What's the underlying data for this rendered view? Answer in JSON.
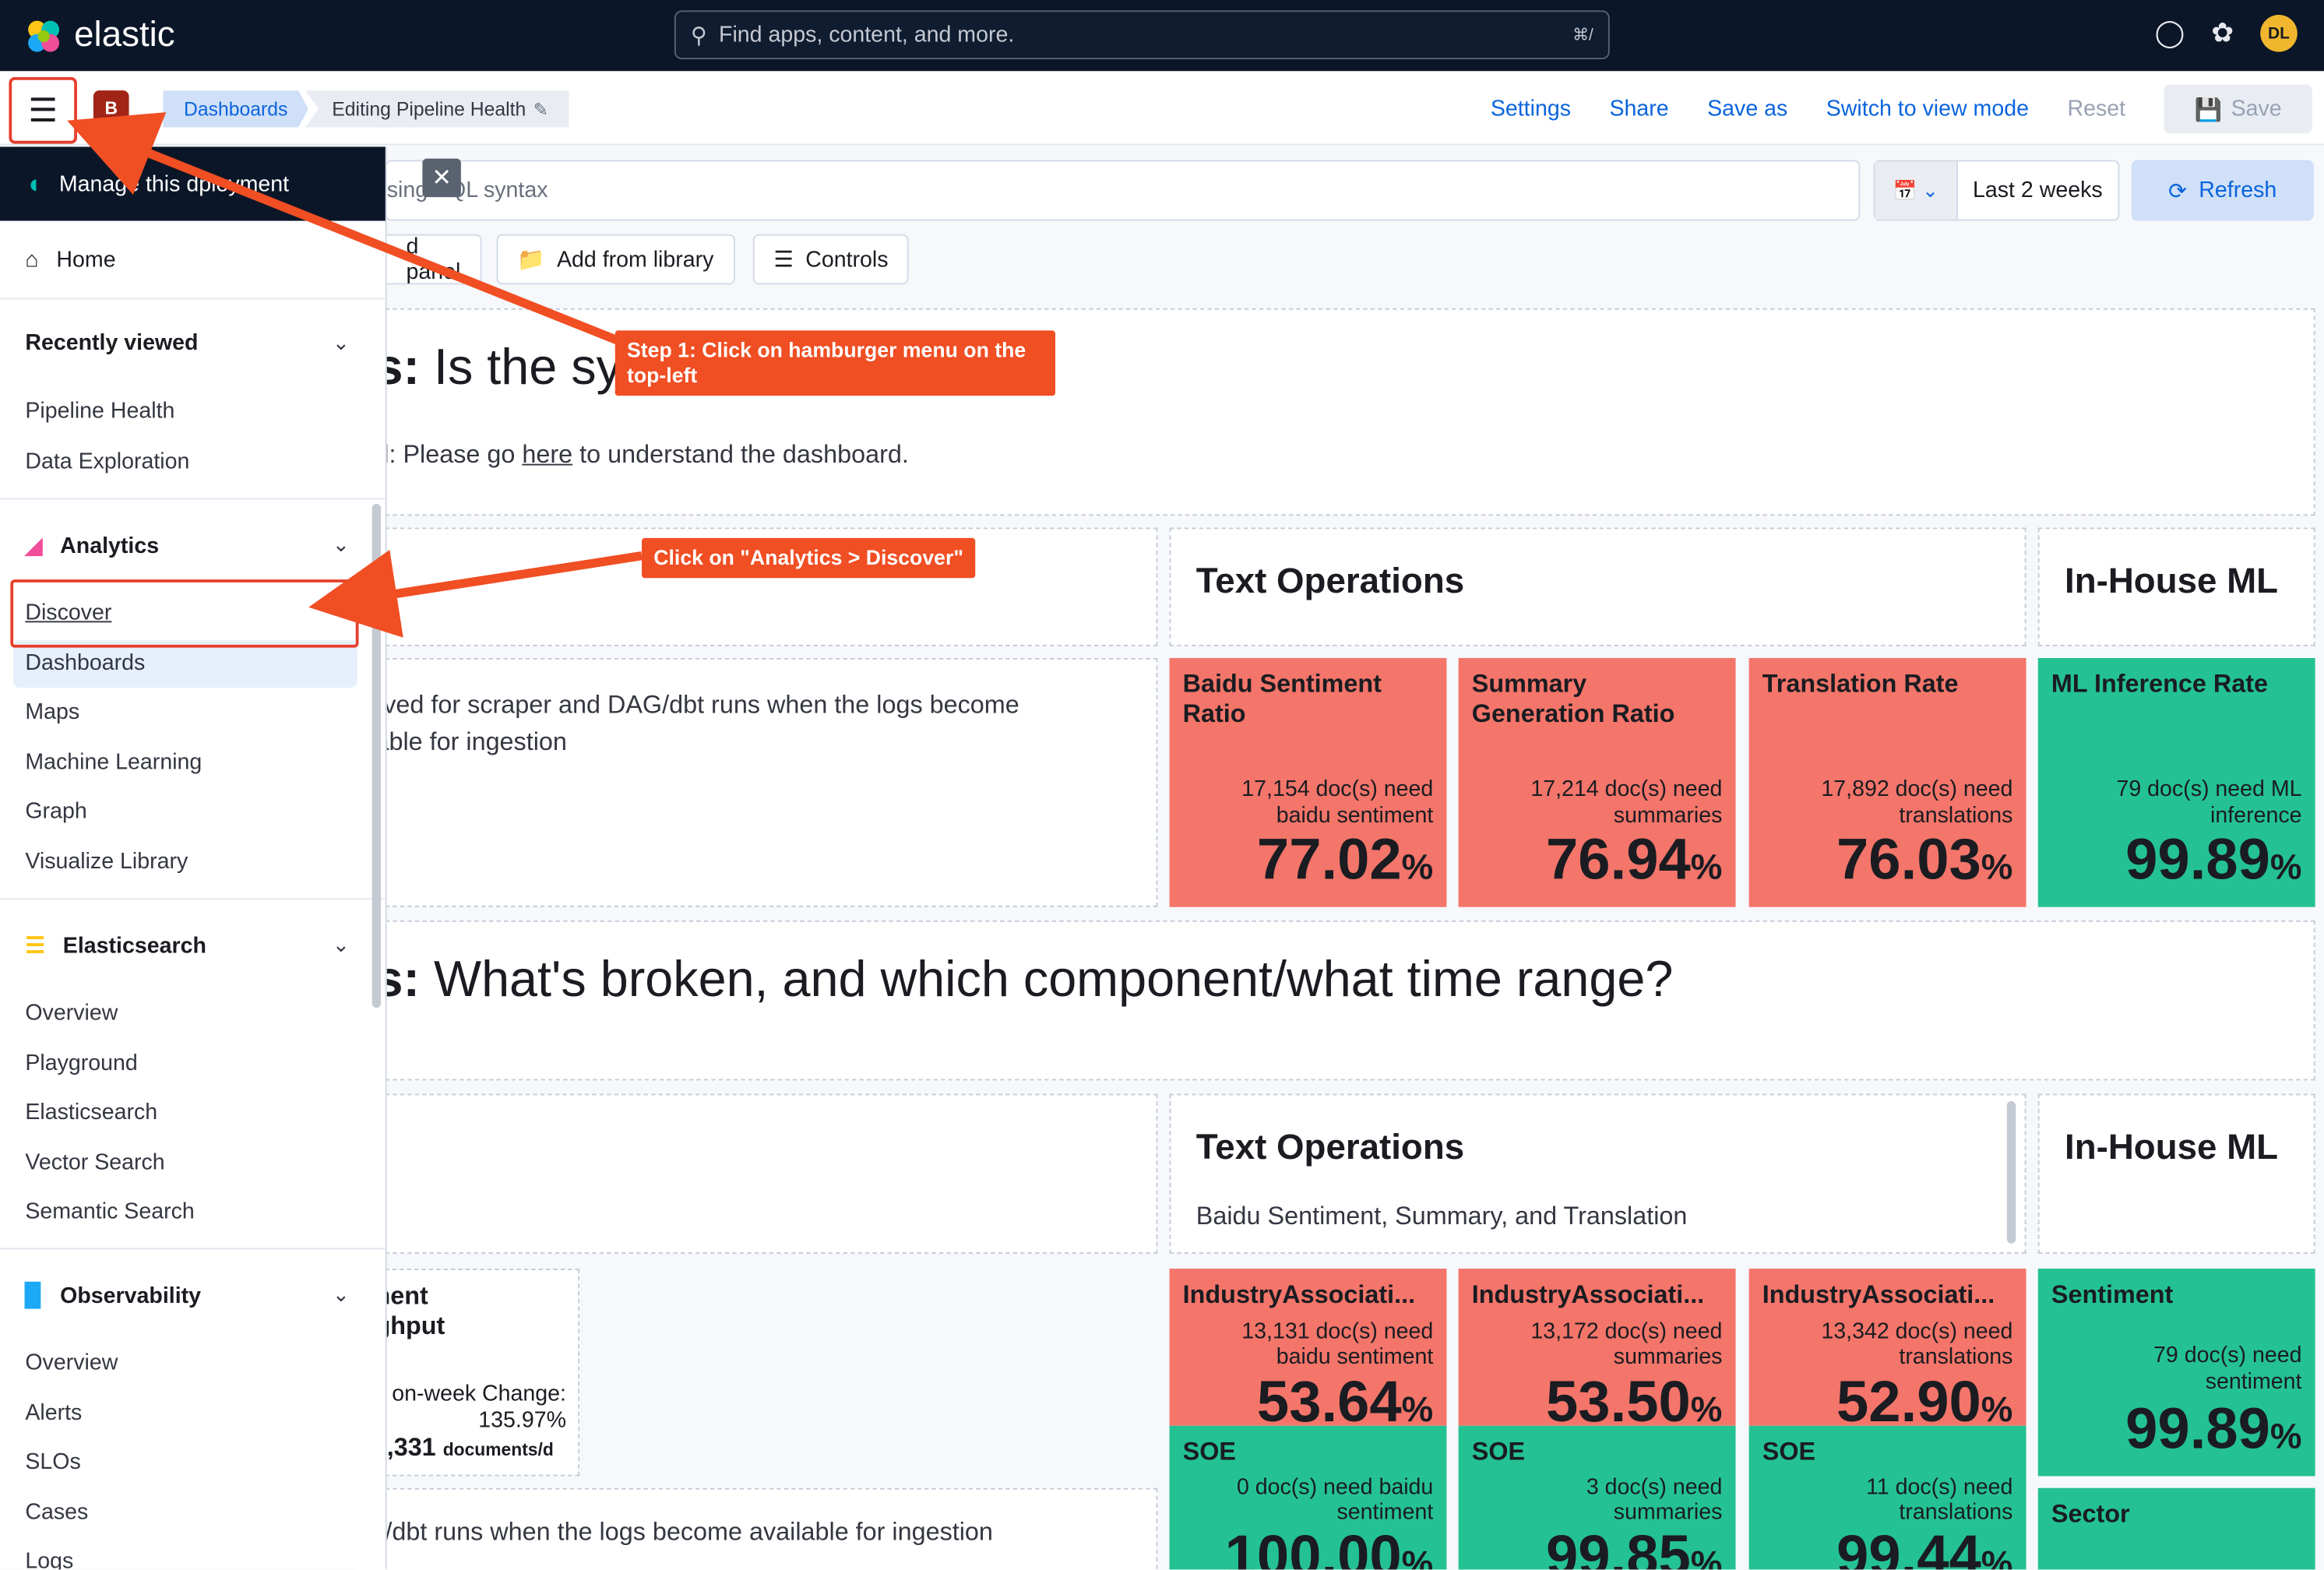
{
  "topbar": {
    "brand": "elastic",
    "search_placeholder": "Find apps, content, and more.",
    "search_shortcut": "⌘/",
    "avatar": "DL"
  },
  "subbar": {
    "space_badge": "B",
    "breadcrumbs": [
      "Dashboards",
      "Editing Pipeline Health"
    ],
    "actions": {
      "settings": "Settings",
      "share": "Share",
      "save_as": "Save as",
      "switch_view": "Switch to view mode",
      "reset": "Reset",
      "save": "Save"
    }
  },
  "query": {
    "placeholder_fragment": "sing KQL syntax",
    "date_label": "Last 2 weeks",
    "refresh": "Refresh"
  },
  "toolbar": {
    "add_panel": "d panel",
    "add_from_library": "Add from library",
    "controls": "Controls"
  },
  "sections": {
    "q1_bold": "s:",
    "q1_text": " Is the sy",
    "q1_sub_prefix": "d: Please go ",
    "q1_link": "here",
    "q1_sub_suffix": " to understand the dashboard.",
    "q2_bold": "s:",
    "q2_text": " What's broken, and which component/what time range?"
  },
  "row1": {
    "text_ops": "Text Operations",
    "inhouse": "In-House ML",
    "note_line1": "rved for scraper and DAG/dbt runs when the logs become",
    "note_line2": "able for ingestion"
  },
  "metrics_top": [
    {
      "title": "Baidu Sentiment Ratio",
      "sub1": "17,154 doc(s) need",
      "sub2": "baidu sentiment",
      "value": "77.02",
      "unit": "%",
      "status": "red"
    },
    {
      "title": "Summary Generation Ratio",
      "sub1": "17,214 doc(s) need",
      "sub2": "summaries",
      "value": "76.94",
      "unit": "%",
      "status": "red"
    },
    {
      "title": "Translation Rate",
      "sub1": "17,892 doc(s) need",
      "sub2": "translations",
      "value": "76.03",
      "unit": "%",
      "status": "red"
    },
    {
      "title": "ML Inference Rate",
      "sub1": "79 doc(s) need ML",
      "sub2": "inference",
      "value": "99.89",
      "unit": "%",
      "status": "green"
    }
  ],
  "row2": {
    "text_ops": "Text Operations",
    "text_ops_sub": "Baidu Sentiment, Summary, and Translation",
    "inhouse": "In-House ML",
    "thr_line1": "nent",
    "thr_line2": "ghput",
    "thr_change1": "on-week Change:",
    "thr_change2": "135.97%",
    "thr_value": ",331",
    "thr_unit": "documents/d",
    "bottom_note": "i/dbt runs when the logs become available for ingestion"
  },
  "metrics_bottom": [
    {
      "title": "IndustryAssociati...",
      "sub1": "13,131 doc(s) need",
      "sub2": "baidu sentiment",
      "value": "53.64",
      "unit": "%"
    },
    {
      "title": "IndustryAssociati...",
      "sub1": "13,172 doc(s) need",
      "sub2": "summaries",
      "value": "53.50",
      "unit": "%"
    },
    {
      "title": "IndustryAssociati...",
      "sub1": "13,342 doc(s) need",
      "sub2": "translations",
      "value": "52.90",
      "unit": "%"
    }
  ],
  "metrics_soe": [
    {
      "title": "SOE",
      "sub1": "0 doc(s) need baidu",
      "sub2": "sentiment",
      "value": "100.00",
      "unit": "%"
    },
    {
      "title": "SOE",
      "sub1": "3 doc(s) need",
      "sub2": "summaries",
      "value": "99.85",
      "unit": "%"
    },
    {
      "title": "SOE",
      "sub1": "11 doc(s) need",
      "sub2": "translations",
      "value": "99.44",
      "unit": "%"
    }
  ],
  "metric_sentiment": {
    "title": "Sentiment",
    "sub1": "79 doc(s) need",
    "sub2": "sentiment",
    "value": "99.89",
    "unit": "%"
  },
  "metric_sector": {
    "title": "Sector"
  },
  "sidebar": {
    "manage": "Manage this d",
    "manage_tail": "ployment",
    "home": "Home",
    "recent_head": "Recently viewed",
    "recent": [
      "Pipeline Health",
      "Data Exploration"
    ],
    "analytics_head": "Analytics",
    "analytics": [
      "Discover",
      "Dashboards",
      "Maps",
      "Machine Learning",
      "Graph",
      "Visualize Library"
    ],
    "es_head": "Elasticsearch",
    "es": [
      "Overview",
      "Playground",
      "Elasticsearch",
      "Vector Search",
      "Semantic Search"
    ],
    "obs_head": "Observability",
    "obs": [
      "Overview",
      "Alerts",
      "SLOs",
      "Cases",
      "Logs"
    ]
  },
  "callouts": {
    "step1_line1": "Step 1: Click on hamburger menu on the",
    "step1_line2": "top-left",
    "step2": "Click on \"Analytics > Discover\""
  },
  "colors": {
    "danger": "#f4756a",
    "success": "#24c292",
    "annotation": "#f04e23",
    "nav_dark": "#0b1628"
  }
}
